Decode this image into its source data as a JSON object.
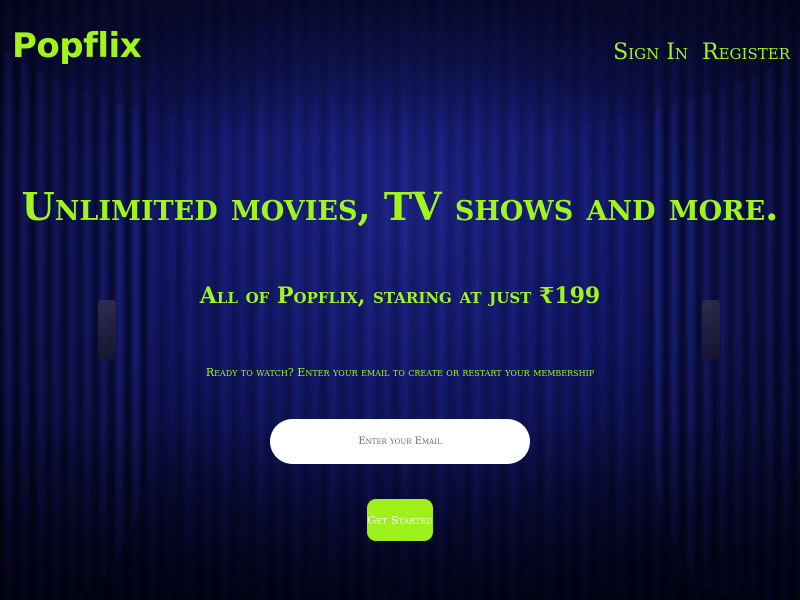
{
  "brand": {
    "logo_text": "Popflix",
    "accent_color": "#a2f51b",
    "background_color": "#0a0d3a"
  },
  "nav": {
    "sign_in": "Sign In",
    "register": "Register"
  },
  "hero": {
    "headline": "Unlimited movies, TV shows and more.",
    "subheadline": "All of Popflix, staring at just ₹199",
    "prompt": "Ready to watch? Enter your email to create or restart your membership",
    "email_placeholder": "Enter your Email",
    "email_value": "",
    "cta_label": "Get Started"
  },
  "background": {
    "image": "blue-stage-curtain"
  }
}
